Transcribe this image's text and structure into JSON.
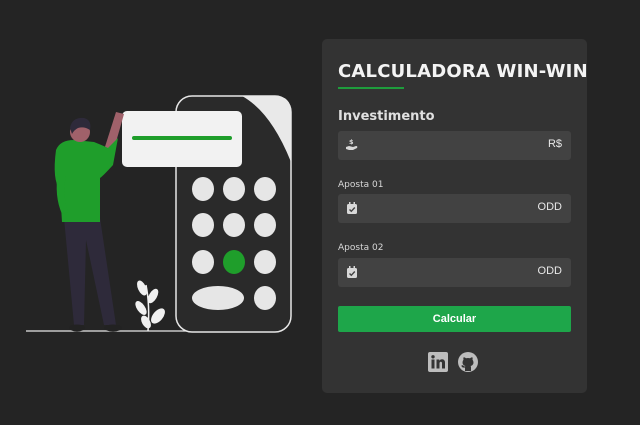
{
  "card": {
    "title": "CALCULADORA WIN-WIN",
    "investment": {
      "label": "Investimento",
      "suffix": "R$",
      "value": "",
      "icon": "hand-dollar-icon"
    },
    "bet1": {
      "label": "Aposta 01",
      "suffix": "ODD",
      "value": "",
      "icon": "calendar-check-icon"
    },
    "bet2": {
      "label": "Aposta 02",
      "suffix": "ODD",
      "value": "",
      "icon": "calendar-check-icon"
    },
    "calculate_label": "Calcular"
  },
  "social": {
    "items": [
      "linkedin-icon",
      "github-icon"
    ]
  },
  "colors": {
    "background": "#242424",
    "card": "#333333",
    "field": "#424242",
    "accent": "#1ea64a",
    "text": "#f4f4f4"
  }
}
